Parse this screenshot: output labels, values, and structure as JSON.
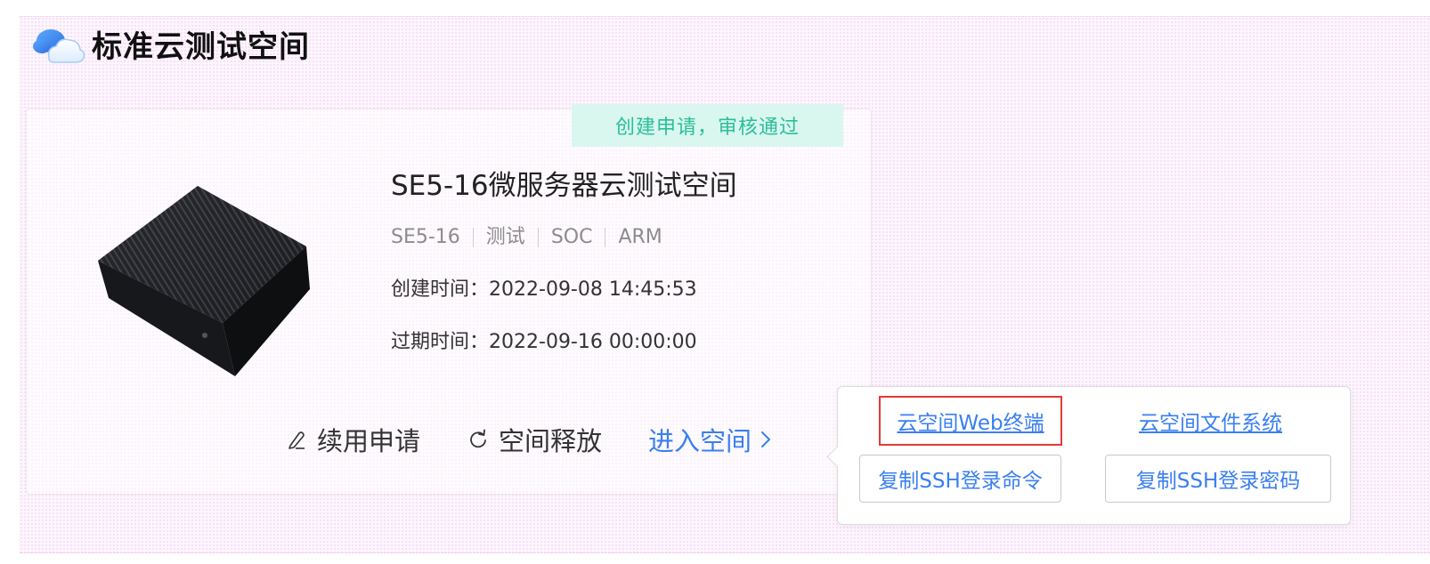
{
  "section": {
    "title": "标准云测试空间",
    "icon": "cloud-icon"
  },
  "card": {
    "status": "创建申请，审核通过",
    "status_color": "#2bbf9a",
    "name": "SE5-16微服务器云测试空间",
    "tags": [
      "SE5-16",
      "测试",
      "SOC",
      "ARM"
    ],
    "created_label": "创建时间：",
    "created_value": "2022-09-08 14:45:53",
    "expire_label": "过期时间：",
    "expire_value": "2022-09-16 00:00:00",
    "image": "server-device-image"
  },
  "actions": {
    "renew_label": "续用申请",
    "renew_icon": "edit-pen-icon",
    "release_label": "空间释放",
    "release_icon": "refresh-icon",
    "enter_label": "进入空间",
    "enter_icon": "chevron-right-icon",
    "accent_color": "#3a7ff0"
  },
  "popover": {
    "web_terminal": "云空间Web终端",
    "file_system": "云空间文件系统",
    "copy_ssh_command": "复制SSH登录命令",
    "copy_ssh_password": "复制SSH登录密码",
    "highlight_color": "#e53935"
  }
}
